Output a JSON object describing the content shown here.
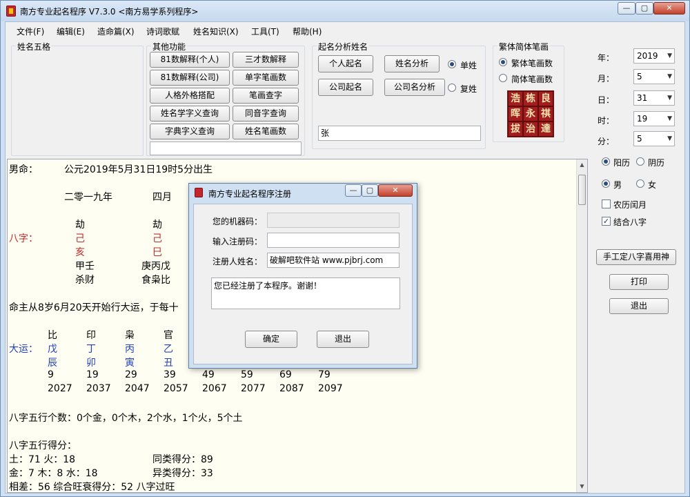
{
  "window": {
    "title": "南方专业起名程序 V7.3.0   <南方易学系列程序>",
    "controls": {
      "minimize": "—",
      "maximize": "▢",
      "close": "✕"
    }
  },
  "menu": [
    "文件(F)",
    "编辑(E)",
    "造命篇(X)",
    "诗词歌赋",
    "姓名知识(X)",
    "工具(T)",
    "帮助(H)"
  ],
  "groups": {
    "wuge": "姓名五格",
    "other": "其他功能",
    "analysis": "起名分析姓名",
    "strokes": "繁体简体笔画"
  },
  "other_buttons": [
    "81数解释(个人)",
    "三才数解释",
    "81数解释(公司)",
    "单字笔画数",
    "人格外格搭配",
    "笔画查字",
    "姓名学字义查询",
    "同音字查询",
    "字典字义查询",
    "姓名笔画数"
  ],
  "analysis": {
    "buttons": [
      "个人起名",
      "姓名分析",
      "公司起名",
      "公司名分析"
    ],
    "radio_single": "单姓",
    "radio_double": "复姓",
    "name_value": "张"
  },
  "strokes": {
    "traditional": "繁体笔画数",
    "simplified": "简体笔画数",
    "stamp_chars": [
      "浩",
      "栋",
      "良",
      "晖",
      "永",
      "祺",
      "拔",
      "治",
      "達"
    ]
  },
  "date": {
    "year_label": "年：",
    "year": "2019",
    "month_label": "月：",
    "month": "5",
    "day_label": "日：",
    "day": "31",
    "hour_label": "时：",
    "hour": "19",
    "minute_label": "分：",
    "minute": "5"
  },
  "options": {
    "solar": "阳历",
    "lunar": "阴历",
    "male": "男",
    "female": "女",
    "leap": "农历闰月",
    "bazi": "结合八字",
    "manual_button": "手工定八字喜用神",
    "print_button": "打印",
    "exit_button": "退出"
  },
  "output": {
    "l1_a": "男命：",
    "l1_b": "公元2019年5月31日19时5分出生",
    "l2_a": "二零一九年",
    "l2_b": "四月",
    "l3_a": "劫",
    "l3_b": "劫",
    "bazi_label": "八字：",
    "l4_a": "己",
    "l4_b": "己",
    "l5_a": "亥",
    "l5_b": "巳",
    "l6_a": "甲壬",
    "l6_b": "庚丙戊",
    "l7_a": "杀财",
    "l7_b": "食枭比",
    "l8": "命主从8岁6月20天开始行大运，于每十",
    "dy_top": [
      "比",
      "印",
      "枭",
      "官"
    ],
    "dayun_label": "大运：",
    "dy_gan": [
      "戊",
      "丁",
      "丙",
      "乙"
    ],
    "dy_zhi": [
      "辰",
      "卯",
      "寅",
      "丑"
    ],
    "ages": [
      "9",
      "19",
      "29",
      "39",
      "49",
      "59",
      "69",
      "79"
    ],
    "years": [
      "2027",
      "2037",
      "2047",
      "2057",
      "2067",
      "2077",
      "2087",
      "2097"
    ],
    "wx_count": "八字五行个数：0个金，0个木，2个水，1个火，5个土",
    "wx_score_title": "八字五行得分：",
    "s1_a": "土：71  火：18",
    "s1_b": "同类得分：89",
    "s2_a": "金：7  木：8  水：18",
    "s2_b": "异类得分：33",
    "s3": "相差：56  综合旺衰得分：52  八字过旺"
  },
  "dialog": {
    "title": "南方专业起名程序注册",
    "machine_label": "您的机器码：",
    "machine_value": "",
    "code_label": "输入注册码：",
    "code_value": "",
    "user_label": "注册人姓名：",
    "user_value": "破解吧软件站  www.pjbrj.com",
    "message": "您已经注册了本程序。谢谢！",
    "ok": "确定",
    "cancel": "退出"
  }
}
